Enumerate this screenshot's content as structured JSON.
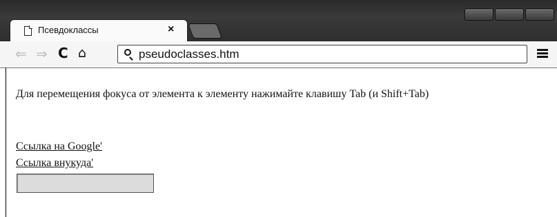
{
  "browser": {
    "tab": {
      "title": "Псевдоклассы",
      "close_glyph": "×"
    },
    "nav": {
      "back_glyph": "⇐",
      "forward_glyph": "⇒",
      "reload_glyph": "C",
      "home_glyph": "⌂"
    },
    "address_bar": {
      "url": "pseudoclasses.htm"
    }
  },
  "page": {
    "instruction": "Для перемещения фокуса от элемента к элементу нажимайте клавишу Tab (и Shift+Tab)",
    "links": [
      {
        "text": "Ссылка на Google'"
      },
      {
        "text": "Ссылка внукуда'"
      }
    ],
    "text_input": {
      "value": ""
    }
  }
}
